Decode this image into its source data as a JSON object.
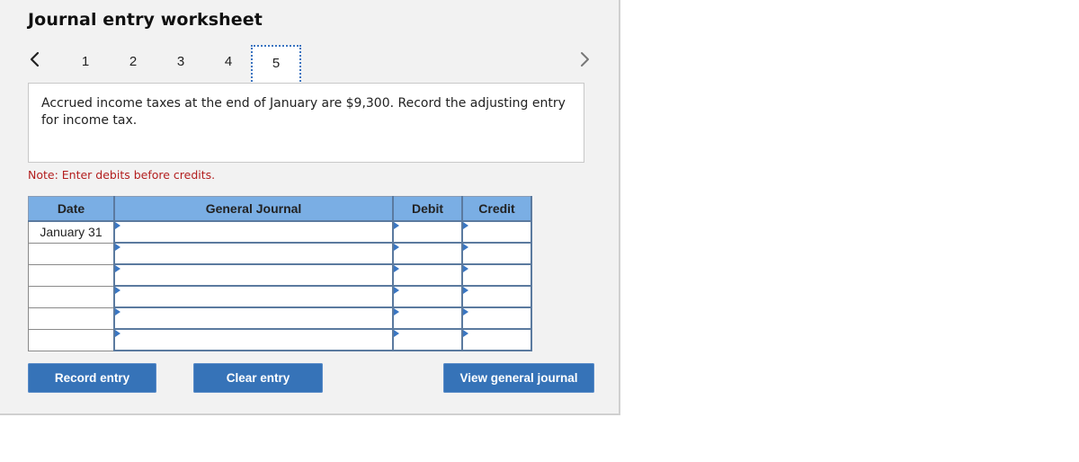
{
  "header": {
    "title": "Journal entry worksheet"
  },
  "navigation": {
    "prev_icon": "chevron-left-icon",
    "next_icon": "chevron-right-icon",
    "steps": [
      {
        "label": "1",
        "active": false
      },
      {
        "label": "2",
        "active": false
      },
      {
        "label": "3",
        "active": false
      },
      {
        "label": "4",
        "active": false
      },
      {
        "label": "5",
        "active": true
      }
    ]
  },
  "question": {
    "text": "Accrued income taxes at the end of January are $9,300. Record the adjusting entry for income tax."
  },
  "note": {
    "text": "Note: Enter debits before credits."
  },
  "table": {
    "headers": {
      "date": "Date",
      "general_journal": "General Journal",
      "debit": "Debit",
      "credit": "Credit"
    },
    "rows": [
      {
        "date": "January 31",
        "account": "",
        "debit": "",
        "credit": ""
      },
      {
        "date": "",
        "account": "",
        "debit": "",
        "credit": ""
      },
      {
        "date": "",
        "account": "",
        "debit": "",
        "credit": ""
      },
      {
        "date": "",
        "account": "",
        "debit": "",
        "credit": ""
      },
      {
        "date": "",
        "account": "",
        "debit": "",
        "credit": ""
      },
      {
        "date": "",
        "account": "",
        "debit": "",
        "credit": ""
      }
    ]
  },
  "buttons": {
    "record_entry": "Record entry",
    "clear_entry": "Clear entry",
    "view_general_journal": "View general journal"
  },
  "colors": {
    "accent": "#3673b8",
    "header_bg": "#7aaee4",
    "note": "#b31e1e",
    "active_step_border": "#3b74c0"
  }
}
